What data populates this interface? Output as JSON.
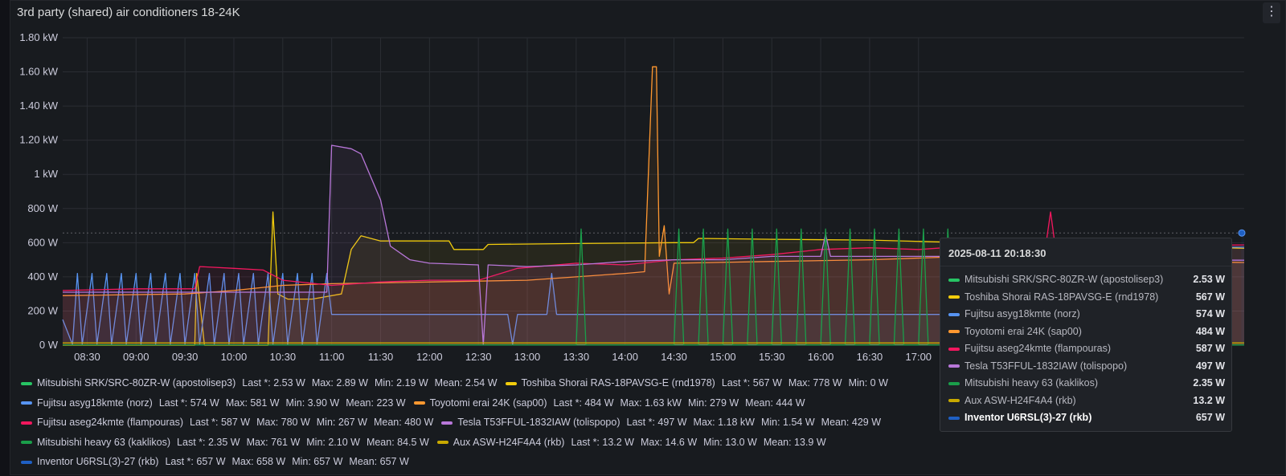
{
  "panel": {
    "title": "3rd party (shared) air conditioners 18-24K",
    "menu_icon": "⋮"
  },
  "chart_data": {
    "type": "line",
    "title": "3rd party (shared) air conditioners 18-24K",
    "ylim": [
      0,
      1800
    ],
    "y_ticks": [
      0,
      200,
      400,
      600,
      800,
      1000,
      1200,
      1400,
      1600,
      1800
    ],
    "y_tick_labels": [
      "0 W",
      "200 W",
      "400 W",
      "600 W",
      "800 W",
      "1 kW",
      "1.20 kW",
      "1.40 kW",
      "1.60 kW",
      "1.80 kW"
    ],
    "x_unit": "hours",
    "xlim": [
      8.25,
      20.33
    ],
    "x_ticks": [
      8.5,
      9,
      9.5,
      10,
      10.5,
      11,
      11.5,
      12,
      12.5,
      13,
      13.5,
      14,
      14.5,
      15,
      15.5,
      16,
      16.5,
      17
    ],
    "x_tick_labels": [
      "08:30",
      "09:00",
      "09:30",
      "10:00",
      "10:30",
      "11:00",
      "11:30",
      "12:00",
      "12:30",
      "13:00",
      "13:30",
      "14:00",
      "14:30",
      "15:00",
      "15:30",
      "16:00",
      "16:30",
      "17:00"
    ],
    "grid": true,
    "series": [
      {
        "name": "Mitsubishi SRK/SRC-80ZR-W (apostolisep3)",
        "color": "#27c464",
        "legend": {
          "last": "Last *: 2.53 W",
          "max": "Max: 2.89 W",
          "min": "Min: 2.19 W",
          "mean": "Mean: 2.54 W"
        },
        "tooltip_value": "2.53 W",
        "points": [
          [
            8.25,
            2
          ],
          [
            20.33,
            2
          ]
        ]
      },
      {
        "name": "Toshiba Shorai RAS-18PAVSG-E (rnd1978)",
        "color": "#f2cc0c",
        "legend": {
          "last": "Last *: 567 W",
          "max": "Max: 778 W",
          "min": "Min: 0 W",
          "mean": ""
        },
        "tooltip_value": "567 W",
        "points": [
          [
            8.25,
            0
          ],
          [
            9.6,
            0
          ],
          [
            9.62,
            420
          ],
          [
            9.7,
            0
          ],
          [
            10.35,
            0
          ],
          [
            10.4,
            780
          ],
          [
            10.45,
            300
          ],
          [
            10.55,
            270
          ],
          [
            10.8,
            270
          ],
          [
            11.1,
            300
          ],
          [
            11.2,
            560
          ],
          [
            11.3,
            640
          ],
          [
            11.5,
            610
          ],
          [
            12.2,
            610
          ],
          [
            12.25,
            560
          ],
          [
            12.55,
            560
          ],
          [
            12.6,
            590
          ],
          [
            13.5,
            595
          ],
          [
            14.5,
            600
          ],
          [
            14.7,
            600
          ],
          [
            14.75,
            625
          ],
          [
            15.5,
            620
          ],
          [
            16.5,
            615
          ],
          [
            17.5,
            600
          ],
          [
            18.5,
            590
          ],
          [
            19.5,
            580
          ],
          [
            20.33,
            567
          ]
        ]
      },
      {
        "name": "Fujitsu asyg18kmte (norz)",
        "color": "#5794f2",
        "legend": {
          "last": "Last *: 574 W",
          "max": "Max: 581 W",
          "min": "Min: 3.90 W",
          "mean": "Mean: 223 W"
        },
        "tooltip_value": "574 W",
        "points": [
          [
            8.25,
            150
          ],
          [
            8.35,
            4
          ],
          [
            8.4,
            420
          ],
          [
            8.45,
            4
          ],
          [
            8.55,
            420
          ],
          [
            8.6,
            4
          ],
          [
            8.7,
            420
          ],
          [
            8.75,
            4
          ],
          [
            8.85,
            420
          ],
          [
            8.9,
            4
          ],
          [
            9.0,
            420
          ],
          [
            9.05,
            4
          ],
          [
            9.15,
            420
          ],
          [
            9.2,
            4
          ],
          [
            9.3,
            420
          ],
          [
            9.35,
            4
          ],
          [
            9.45,
            420
          ],
          [
            9.5,
            4
          ],
          [
            9.6,
            420
          ],
          [
            9.65,
            4
          ],
          [
            9.75,
            420
          ],
          [
            9.8,
            4
          ],
          [
            9.9,
            420
          ],
          [
            9.95,
            4
          ],
          [
            10.05,
            420
          ],
          [
            10.1,
            4
          ],
          [
            10.2,
            420
          ],
          [
            10.25,
            4
          ],
          [
            10.35,
            420
          ],
          [
            10.4,
            4
          ],
          [
            10.5,
            420
          ],
          [
            10.55,
            4
          ],
          [
            10.65,
            420
          ],
          [
            10.7,
            4
          ],
          [
            10.8,
            420
          ],
          [
            10.85,
            4
          ],
          [
            10.95,
            420
          ],
          [
            11.0,
            180
          ],
          [
            12.8,
            180
          ],
          [
            12.85,
            4
          ],
          [
            12.9,
            180
          ],
          [
            13.2,
            180
          ],
          [
            13.25,
            420
          ],
          [
            13.3,
            180
          ],
          [
            16.5,
            180
          ],
          [
            17.5,
            180
          ],
          [
            17.7,
            575
          ],
          [
            20.33,
            574
          ]
        ]
      },
      {
        "name": "Toyotomi erai 24K (sap00)",
        "color": "#ff9830",
        "legend": {
          "last": "Last *: 484 W",
          "max": "Max: 1.63 kW",
          "min": "Min: 279 W",
          "mean": "Mean: 444 W"
        },
        "tooltip_value": "484 W",
        "points": [
          [
            8.25,
            290
          ],
          [
            9.5,
            300
          ],
          [
            10.0,
            320
          ],
          [
            10.5,
            350
          ],
          [
            11.0,
            360
          ],
          [
            12.0,
            370
          ],
          [
            13.0,
            380
          ],
          [
            13.5,
            400
          ],
          [
            14.0,
            420
          ],
          [
            14.2,
            430
          ],
          [
            14.28,
            1630
          ],
          [
            14.32,
            1630
          ],
          [
            14.35,
            520
          ],
          [
            14.4,
            700
          ],
          [
            14.45,
            300
          ],
          [
            14.5,
            480
          ],
          [
            15.5,
            490
          ],
          [
            16.5,
            500
          ],
          [
            17.5,
            520
          ],
          [
            18.5,
            510
          ],
          [
            19.5,
            490
          ],
          [
            20.33,
            484
          ]
        ]
      },
      {
        "name": "Fujitsu aseg24kmte (flampouras)",
        "color": "#f2175e",
        "legend": {
          "last": "Last *: 587 W",
          "max": "Max: 780 W",
          "min": "Min: 267 W",
          "mean": "Mean: 480 W"
        },
        "tooltip_value": "587 W",
        "points": [
          [
            8.25,
            320
          ],
          [
            9.0,
            330
          ],
          [
            9.6,
            330
          ],
          [
            9.65,
            460
          ],
          [
            10.0,
            450
          ],
          [
            10.3,
            440
          ],
          [
            10.5,
            380
          ],
          [
            11.0,
            350
          ],
          [
            11.5,
            370
          ],
          [
            12.0,
            380
          ],
          [
            12.5,
            380
          ],
          [
            12.9,
            450
          ],
          [
            13.5,
            480
          ],
          [
            14.0,
            470
          ],
          [
            14.5,
            500
          ],
          [
            15.0,
            510
          ],
          [
            15.5,
            530
          ],
          [
            16.0,
            560
          ],
          [
            16.5,
            570
          ],
          [
            17.0,
            560
          ],
          [
            17.5,
            580
          ],
          [
            18.3,
            580
          ],
          [
            18.35,
            780
          ],
          [
            18.4,
            570
          ],
          [
            19.0,
            580
          ],
          [
            20.33,
            587
          ]
        ]
      },
      {
        "name": "Tesla T53FFUL-1832IAW (tolispopo)",
        "color": "#b877d9",
        "legend": {
          "last": "Last *: 497 W",
          "max": "Max: 1.18 kW",
          "min": "Min: 1.54 W",
          "mean": "Mean: 429 W"
        },
        "tooltip_value": "497 W",
        "points": [
          [
            8.25,
            310
          ],
          [
            10.95,
            310
          ],
          [
            11.0,
            1170
          ],
          [
            11.2,
            1150
          ],
          [
            11.3,
            1120
          ],
          [
            11.5,
            850
          ],
          [
            11.6,
            580
          ],
          [
            11.8,
            500
          ],
          [
            12.0,
            480
          ],
          [
            12.5,
            470
          ],
          [
            12.55,
            2
          ],
          [
            12.6,
            470
          ],
          [
            13.0,
            460
          ],
          [
            13.5,
            470
          ],
          [
            14.0,
            490
          ],
          [
            14.5,
            500
          ],
          [
            15.0,
            500
          ],
          [
            15.5,
            520
          ],
          [
            16.0,
            520
          ],
          [
            16.05,
            650
          ],
          [
            16.1,
            520
          ],
          [
            16.5,
            520
          ],
          [
            17.5,
            520
          ],
          [
            18.5,
            510
          ],
          [
            19.5,
            500
          ],
          [
            20.33,
            497
          ]
        ]
      },
      {
        "name": "Mitsubishi heavy 63 (kaklikos)",
        "color": "#1a9e4a",
        "legend": {
          "last": "Last *: 2.35 W",
          "max": "Max: 761 W",
          "min": "Min: 2.10 W",
          "mean": "Mean: 84.5 W"
        },
        "tooltip_value": "2.35 W",
        "points": [
          [
            8.25,
            2
          ],
          [
            13.5,
            2
          ],
          [
            13.55,
            680
          ],
          [
            13.6,
            2
          ],
          [
            14.5,
            2
          ],
          [
            14.55,
            680
          ],
          [
            14.6,
            2
          ],
          [
            14.75,
            2
          ],
          [
            14.8,
            680
          ],
          [
            14.85,
            2
          ],
          [
            15.0,
            2
          ],
          [
            15.05,
            680
          ],
          [
            15.1,
            2
          ],
          [
            15.25,
            2
          ],
          [
            15.3,
            680
          ],
          [
            15.35,
            2
          ],
          [
            15.5,
            2
          ],
          [
            15.55,
            680
          ],
          [
            15.6,
            2
          ],
          [
            15.75,
            2
          ],
          [
            15.8,
            680
          ],
          [
            15.85,
            2
          ],
          [
            16.0,
            2
          ],
          [
            16.05,
            680
          ],
          [
            16.1,
            2
          ],
          [
            16.25,
            2
          ],
          [
            16.3,
            680
          ],
          [
            16.35,
            2
          ],
          [
            16.5,
            2
          ],
          [
            16.55,
            680
          ],
          [
            16.6,
            2
          ],
          [
            16.75,
            2
          ],
          [
            16.8,
            680
          ],
          [
            16.85,
            2
          ],
          [
            17.0,
            2
          ],
          [
            17.05,
            680
          ],
          [
            17.1,
            2
          ],
          [
            17.25,
            2
          ],
          [
            17.3,
            680
          ],
          [
            17.35,
            2
          ],
          [
            20.33,
            2
          ]
        ]
      },
      {
        "name": "Aux ASW-H24F4A4 (rkb)",
        "color": "#c9a900",
        "legend": {
          "last": "Last *: 13.2 W",
          "max": "Max: 14.6 W",
          "min": "Min: 13.0 W",
          "mean": "Mean: 13.9 W"
        },
        "tooltip_value": "13.2 W",
        "points": [
          [
            8.25,
            13
          ],
          [
            20.33,
            13
          ]
        ]
      },
      {
        "name": "Inventor U6RSL(3)-27 (rkb)",
        "color": "#1f60c4",
        "legend": {
          "last": "Last *: 657 W",
          "max": "Max: 658 W",
          "min": "Min: 657 W",
          "mean": "Mean: 657 W"
        },
        "tooltip_value": "657 W",
        "points": [
          [
            20.3,
            657
          ],
          [
            20.33,
            657
          ]
        ]
      }
    ]
  },
  "tooltip": {
    "time": "2025-08-11 20:18:30",
    "active_index": 8
  }
}
